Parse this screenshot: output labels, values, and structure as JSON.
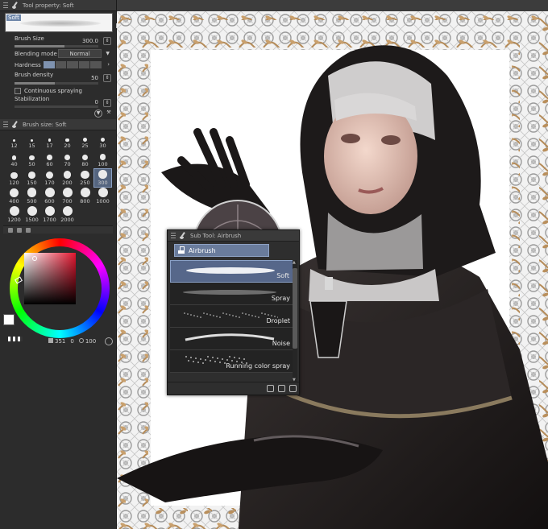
{
  "tool_property": {
    "title": "Tool property: Soft",
    "preview_label": "Soft",
    "brush_size_label": "Brush Size",
    "brush_size_value": "300.0",
    "blending_mode_label": "Blending mode",
    "blending_mode_value": "Normal",
    "hardness_label": "Hardness",
    "brush_density_label": "Brush density",
    "brush_density_value": "50",
    "continuous_spraying_label": "Continuous spraying",
    "stabilization_label": "Stabilization",
    "stabilization_value": "0"
  },
  "brush_size_panel": {
    "title": "Brush size: Soft",
    "sizes": [
      "12",
      "15",
      "17",
      "20",
      "25",
      "30",
      "40",
      "50",
      "60",
      "70",
      "80",
      "100",
      "120",
      "150",
      "170",
      "200",
      "250",
      "300",
      "400",
      "500",
      "600",
      "700",
      "800",
      "1000",
      "1200",
      "1500",
      "1700",
      "2000"
    ],
    "selected": "300"
  },
  "color_panel": {
    "main_color": "#ffffff",
    "sub_color": "#000000",
    "hue_color": "#e3162f",
    "value_a": "351",
    "value_b": "0",
    "value_c": "100"
  },
  "sub_tool": {
    "title": "Sub Tool: Airbrush",
    "group_label": "Airbrush",
    "items": [
      "Soft",
      "Spray",
      "Droplet",
      "Noise",
      "Running color spray"
    ],
    "selected": "Soft"
  },
  "icons": [
    "brush-icon",
    "airbrush-icon",
    "lock-icon",
    "gear-icon",
    "settings-icon",
    "wrench-icon",
    "add-icon",
    "duplicate-icon",
    "trash-icon"
  ]
}
